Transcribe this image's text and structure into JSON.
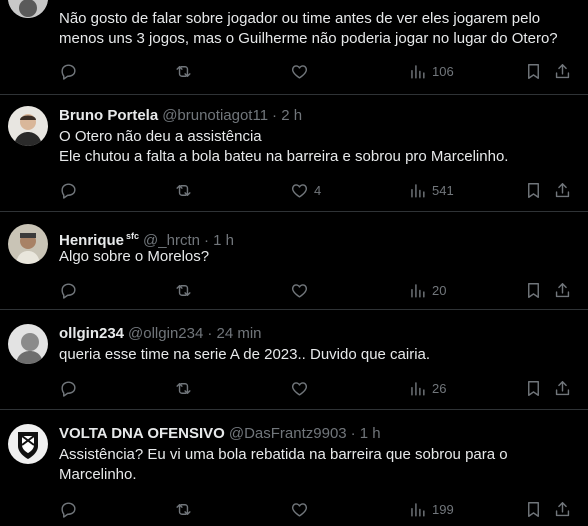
{
  "tweets": [
    {
      "name": "",
      "handle": "",
      "time": "",
      "text": "Não gosto de falar sobre jogador ou time antes de ver eles jogarem pelo menos uns 3 jogos, mas o Guilherme não poderia jogar no lugar do Otero?",
      "likes": "",
      "views": "106"
    },
    {
      "name": "Bruno Portela",
      "handle": "@brunotiagot11",
      "time": "· 2 h",
      "text": "O Otero não deu a assistência\nEle chutou a falta a bola bateu na barreira e sobrou pro Marcelinho.",
      "likes": "4",
      "views": "541"
    },
    {
      "name": "Henrique",
      "badge": "sfc",
      "handle": "@_hrctn",
      "time": "· 1 h",
      "text": "Algo sobre o Morelos?",
      "likes": "",
      "views": "20"
    },
    {
      "name": "ollgin234",
      "handle": "@ollgin234",
      "time": "· 24 min",
      "text": "queria esse time na serie A de 2023.. Duvido que cairia.",
      "likes": "",
      "views": "26"
    },
    {
      "name": "VOLTA DNA OFENSIVO",
      "handle": "@DasFrantz9903",
      "time": "· 1 h",
      "text": "Assistência? Eu vi uma bola rebatida na barreira que sobrou para o Marcelinho.",
      "likes": "",
      "views": "199"
    }
  ],
  "colors": {
    "background": "#000000",
    "text": "#e7e9ea",
    "muted": "#71767b",
    "divider": "#2f3336"
  }
}
